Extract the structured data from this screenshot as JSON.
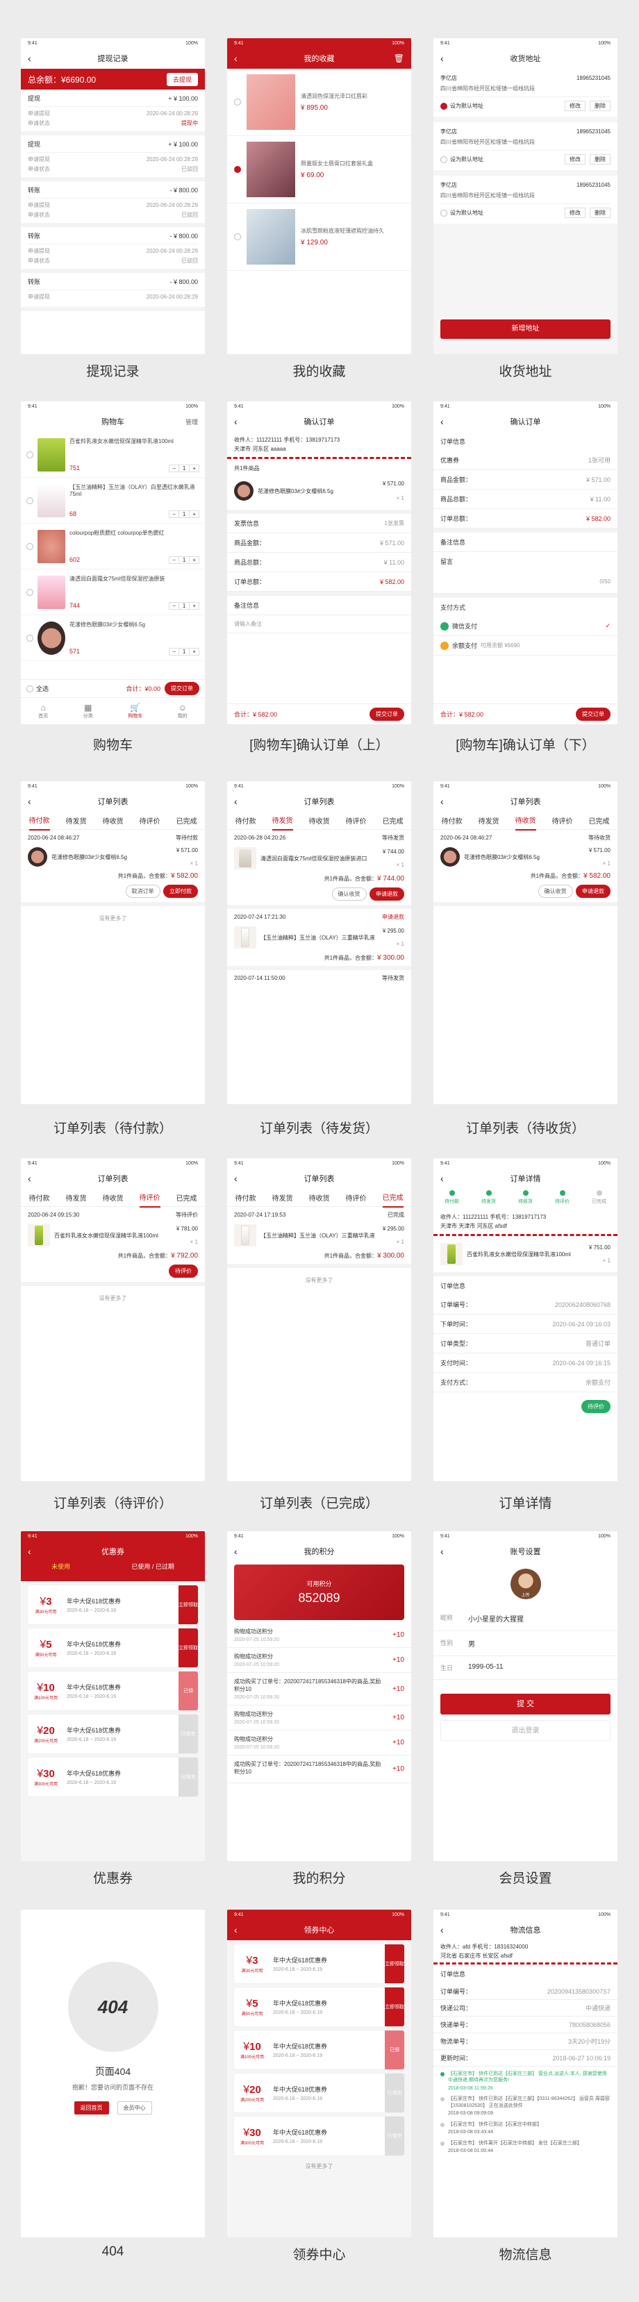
{
  "captions": [
    "提现记录",
    "我的收藏",
    "收货地址",
    "购物车",
    "[购物车]确认订单（上）",
    "[购物车]确认订单（下）",
    "订单列表（待付款）",
    "订单列表（待发货）",
    "订单列表（待收货）",
    "订单列表（待评价）",
    "订单列表（已完成）",
    "订单详情",
    "优惠券",
    "我的积分",
    "会员设置",
    "404",
    "领券中心",
    "物流信息"
  ],
  "status_time": "9:41",
  "status_right": "100%",
  "withdraw": {
    "title": "提现记录",
    "total_label": "总余额：¥6690.00",
    "btn": "去提现",
    "items": [
      {
        "name": "提现",
        "amount": "+ ¥ 100.00",
        "l1": "申请提现",
        "t1": "2020-06-24 00:28:29",
        "l2": "申请状态",
        "s2": "提现中"
      },
      {
        "name": "提现",
        "amount": "+ ¥ 100.00",
        "l1": "申请提现",
        "t1": "2020-06-24 00:28:29",
        "l2": "申请状态",
        "s2": "已驳回"
      },
      {
        "name": "转账",
        "amount": "- ¥ 800.00",
        "l1": "申请提现",
        "t1": "2020-06-24 00:28:29",
        "l2": "申请状态",
        "s2": "已驳回"
      },
      {
        "name": "转账",
        "amount": "- ¥ 800.00",
        "l1": "申请提现",
        "t1": "2020-06-24 00:28:29",
        "l2": "申请状态",
        "s2": "已驳回"
      },
      {
        "name": "转账",
        "amount": "- ¥ 800.00",
        "l1": "申请提现",
        "t1": "2020-06-24 00:28:29",
        "l2": "",
        "s2": ""
      }
    ]
  },
  "collect": {
    "title": "我的收藏",
    "items": [
      {
        "desc": "清透润色保湿光泽口红唇彩",
        "price": "¥ 895.00"
      },
      {
        "desc": "限量版女士唇膏口红套装礼盒",
        "price": "¥ 69.00"
      },
      {
        "desc": "冰肌雪颜粉底液轻薄遮瑕控油持久",
        "price": "¥ 129.00"
      }
    ]
  },
  "address": {
    "title": "收货地址",
    "items": [
      {
        "name": "李亿店",
        "phone": "18965231045",
        "addr": "四川省绵阳市经开区松垭镇一组栈坑段",
        "default": "设为默认地址",
        "edit": "修改",
        "del": "删除"
      },
      {
        "name": "李亿店",
        "phone": "18965231045",
        "addr": "四川省绵阳市经开区松垭镇一组栈坑段",
        "default": "设为默认地址",
        "edit": "修改",
        "del": "删除"
      },
      {
        "name": "李亿店",
        "phone": "18965231045",
        "addr": "四川省绵阳市经开区松垭镇一组栈坑段",
        "default": "设为默认地址",
        "edit": "修改",
        "del": "删除"
      }
    ],
    "btn": "新增地址"
  },
  "cart": {
    "title": "购物车",
    "manage": "管理",
    "items": [
      {
        "name": "百雀羚乳液女水嫩倍现保湿精华乳液100ml",
        "price": "751",
        "qty": "1"
      },
      {
        "name": "【玉兰油精粹】玉兰油（OLAY）白里透红水嫩乳液75ml",
        "price": "68",
        "qty": "1"
      },
      {
        "name": "colourpop粉质腮红 colourpop单色腮红",
        "price": "602",
        "qty": "1"
      },
      {
        "name": "清透润白面霜女75ml倍现保湿控油原装",
        "price": "744",
        "qty": "1"
      },
      {
        "name": "花漾修色眼膜03#少女樱桃6.5g",
        "price": "571",
        "qty": "1"
      }
    ],
    "all": "全选",
    "total": "合计：¥0.00",
    "btn": "提交订单",
    "tabbar": [
      "首页",
      "分类",
      "购物车",
      "我的"
    ]
  },
  "confirm_top": {
    "title": "确认订单",
    "recv": "收件人：111221111  手机号：13819717173",
    "addr": "天津市 河东区 aaaaa",
    "count": "共1件商品",
    "item": "花漾修色眼膜03#少女樱桃6.5g",
    "price": "¥ 571.00",
    "qty": "× 1",
    "info": "发票信息",
    "info_v": "1张发票",
    "rows": [
      [
        "商品金额：",
        "¥ 571.00"
      ],
      [
        "商品总额：",
        "¥ 11.00"
      ],
      [
        "订单总额：",
        "¥ 582.00"
      ]
    ],
    "remark": "备注信息",
    "remark_ph": "请输入备注",
    "total": "合计：¥ 582.00",
    "btn": "提交订单"
  },
  "confirm_bot": {
    "title": "确认订单",
    "info": "订单信息",
    "rows": [
      [
        "优惠券",
        "1张可用"
      ],
      [
        "商品金额：",
        "¥ 571.00"
      ],
      [
        "商品总额：",
        "¥ 11.00"
      ],
      [
        "订单总额：",
        "¥ 582.00"
      ]
    ],
    "remark": "备注信息",
    "remark_l": "留言",
    "count": "0/50",
    "pay": "支付方式",
    "pay1": "微信支付",
    "pay2": "余额支付",
    "pay2s": "可用余额 ¥6690",
    "total": "合计：¥ 582.00",
    "btn": "提交订单"
  },
  "order_tabs": [
    "待付款",
    "待发货",
    "待收货",
    "待评价",
    "已完成"
  ],
  "order_title": "订单列表",
  "ord1": {
    "date": "2020-06-24 08:46:27",
    "state": "等待付款",
    "item": "花漾修色眼膜03#少女樱桃6.5g",
    "price": "¥ 571.00",
    "qty": "× 1",
    "sum": "共1件商品，合金额：",
    "sumv": "¥ 582.00",
    "b1": "取消订单",
    "b2": "立即付款",
    "more": "没有更多了"
  },
  "ord2": {
    "date": "2020-06-28 04:20:26",
    "state": "等待发货",
    "item": "清透润白面霜女75ml倍现保湿控油原装进口",
    "price": "¥ 744.00",
    "qty": "× 1",
    "sum": "共1件商品，合金额：",
    "sumv": "¥ 744.00",
    "b1": "确认收货",
    "b2": "申请退款",
    "date2": "2020-07-24 17:21:30",
    "state2": "申请退款",
    "item2": "【玉兰油精粹】玉兰油（OLAY）三重精华乳液",
    "price2": "¥ 295.00",
    "sumv2": "¥ 300.00",
    "date3": "2020-07-14 11:50:00",
    "state3": "等待发货"
  },
  "ord3": {
    "date": "2020-06-24 08:46:27",
    "state": "等待收货",
    "item": "花漾修色眼膜03#少女樱桃6.5g",
    "price": "¥ 571.00",
    "qty": "× 1",
    "sum": "共1件商品，合金额：",
    "sumv": "¥ 582.00",
    "b1": "确认收货",
    "b2": "申请退款"
  },
  "ord4": {
    "date": "2020-06-24 09:15:30",
    "state": "等待评价",
    "item": "百雀羚乳液女水嫩倍现保湿精华乳液100ml",
    "price": "¥ 781.00",
    "qty": "× 1",
    "sum": "共1件商品，合金额：",
    "sumv": "¥ 792.00",
    "b": "待评价",
    "more": "没有更多了"
  },
  "ord5": {
    "date": "2020-07-24 17:19:53",
    "state": "已完成",
    "item": "【玉兰油精粹】玉兰油（OLAY）三重精华乳液",
    "price": "¥ 295.00",
    "qty": "× 1",
    "sum": "共1件商品，合金额：",
    "sumv": "¥ 300.00",
    "more": "没有更多了"
  },
  "detail": {
    "title": "订单详情",
    "steps": [
      "待付款",
      "待发货",
      "待收货",
      "待评价",
      "已完成"
    ],
    "recv": "收件人：111221111  手机号：13819717173",
    "addr": "天津市 天津市 河东区 afsdf",
    "item": "百雀羚乳液女水嫩倍现保湿精华乳液100ml",
    "price": "¥ 751.00",
    "qty": "× 1",
    "sec": "订单信息",
    "rows": [
      [
        "订单编号：",
        "2020062408060768"
      ],
      [
        "下单时间：",
        "2020-06-24 09:16:03"
      ],
      [
        "订单类型：",
        "普通订单"
      ],
      [
        "支付时间：",
        "2020-06-24 09:16:15"
      ],
      [
        "支付方式：",
        "余额支付"
      ]
    ],
    "btn": "待评价"
  },
  "coupon": {
    "title": "优惠券",
    "tab1": "未使用",
    "tab2": "已使用 / 已过期",
    "items": [
      {
        "v": "3",
        "cond": "满30元可用",
        "name": "年中大促618优惠券",
        "date": "2020-6.18 ~ 2020-6.19",
        "act": "立即领取",
        "k": "r"
      },
      {
        "v": "5",
        "cond": "满50元可用",
        "name": "年中大促618优惠券",
        "date": "2020-6.18 ~ 2020-6.19",
        "act": "立即领取",
        "k": "r"
      },
      {
        "v": "10",
        "cond": "满100元可用",
        "name": "年中大促618优惠券",
        "date": "2020-6.18 ~ 2020-6.19",
        "act": "已领",
        "k": "p"
      },
      {
        "v": "20",
        "cond": "满200元可用",
        "name": "年中大促618优惠券",
        "date": "2020-6.18 ~ 2020-6.19",
        "act": "已领完",
        "k": "g"
      },
      {
        "v": "30",
        "cond": "满300元可用",
        "name": "年中大促618优惠券",
        "date": "2020-6.18 ~ 2020-6.19",
        "act": "已领完",
        "k": "g"
      }
    ]
  },
  "points": {
    "title": "我的积分",
    "label": "可用积分",
    "value": "852089",
    "items": [
      {
        "t": "购物成功送积分",
        "d": "2020-07-25 10:59:20",
        "v": "+10"
      },
      {
        "t": "购物成功送积分",
        "d": "2020-07-25 10:59:20",
        "v": "+10"
      },
      {
        "t": "成功购买了订单号：20200724171855346318中的商品,奖励积分10",
        "d": "2020-07-25 10:59:20",
        "v": "+10"
      },
      {
        "t": "购物成功送积分",
        "d": "2020-07-25 10:59:20",
        "v": "+10"
      },
      {
        "t": "购物成功送积分",
        "d": "2020-07-25 10:59:20",
        "v": "+10"
      },
      {
        "t": "成功购买了订单号：20200724171855346318中的商品,奖励积分10",
        "d": "",
        "v": "+10"
      }
    ]
  },
  "member": {
    "title": "账号设置",
    "avatar": "上传",
    "rows": [
      [
        "昵称",
        "小小星星的大猩猩"
      ],
      [
        "性别",
        "男"
      ],
      [
        "生日",
        "1999-05-11"
      ]
    ],
    "btn": "提 交",
    "logout": "退出登录"
  },
  "p404": {
    "code": "404",
    "t": "页面404",
    "d": "抱歉！您要访问的页面不存在",
    "b1": "返回首页",
    "b2": "会员中心"
  },
  "center": {
    "title": "领券中心",
    "more": "没有更多了"
  },
  "logistics": {
    "title": "物流信息",
    "recv": "收件人：afd  手机号：18316324000",
    "addr": "河北省 石家庄市 长安区 afsdf",
    "sec": "订单信息",
    "rows": [
      [
        "订单编号：",
        "2020094135803007S7"
      ],
      [
        "快递公司：",
        "中通快递"
      ],
      [
        "快递单号：",
        "780058068056"
      ],
      [
        "物流单号：",
        "3天20小时19分"
      ],
      [
        "更新时间：",
        "2018-06-27 10:06:19"
      ]
    ],
    "tracks": [
      {
        "t": "【石家庄市】 快件已到达【石家庄三部】 营业点,派送人:本人, 感谢您使用中通快递,期待再次为您服务!",
        "d": "2018-03-08 11:59:26",
        "on": true
      },
      {
        "t": "【石家庄市】 快件已到达【石家庄三部】【0311-86344262】 运营员 周碧容【15308102530】 正在派送此快件",
        "d": "2018-03-08 09:09:09",
        "on": false
      },
      {
        "t": "【石家庄市】 快件已到达【石家庄中转部】",
        "d": "2018-03-08 03:43:44",
        "on": false
      },
      {
        "t": "【石家庄市】 快件离开【石家庄中转部】 发往【石家庄三部】",
        "d": "2018-03-08 01:00:44",
        "on": false
      }
    ]
  }
}
